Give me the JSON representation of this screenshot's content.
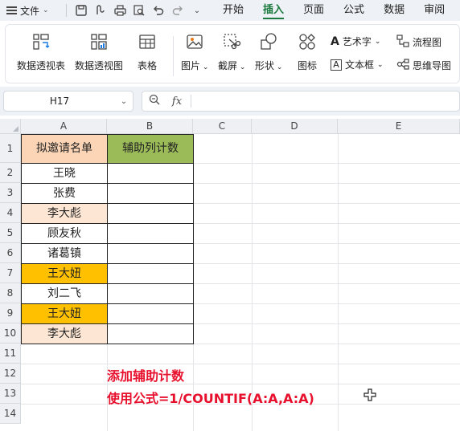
{
  "menu": {
    "file_label": "文件",
    "tabs": [
      "开始",
      "插入",
      "页面",
      "公式",
      "数据",
      "审阅"
    ],
    "active_tab": "插入"
  },
  "ribbon": {
    "pivot_table": "数据透视表",
    "pivot_chart": "数据透视图",
    "table": "表格",
    "picture": "图片",
    "screenshot": "截屏",
    "shapes": "形状",
    "icons": "图标",
    "wordart": "艺术字",
    "textbox": "文本框",
    "flowchart": "流程图",
    "mindmap": "思维导图"
  },
  "formula_bar": {
    "name_box": "H17",
    "fx_label": "fx",
    "formula": ""
  },
  "sheet": {
    "columns": [
      "A",
      "B",
      "C",
      "D",
      "E"
    ],
    "rows": [
      "1",
      "2",
      "3",
      "4",
      "5",
      "6",
      "7",
      "8",
      "9",
      "10",
      "11",
      "12",
      "13",
      "14"
    ],
    "header": {
      "a1": "拟邀请名单",
      "b1": "辅助列计数"
    },
    "names": [
      "王晓",
      "张费",
      "李大彪",
      "顾友秋",
      "诸葛镇",
      "王大妞",
      "刘二飞",
      "王大妞",
      "李大彪"
    ],
    "name_fills": [
      "#ffffff",
      "#ffffff",
      "#fde6d3",
      "#ffffff",
      "#ffffff",
      "#ffc000",
      "#ffffff",
      "#ffc000",
      "#fde6d3"
    ],
    "header_fills": {
      "a1": "#fbd5b5",
      "b1": "#9bbb59"
    }
  },
  "annotation": {
    "line1": "添加辅助计数",
    "line2": "使用公式=1/COUNTIF(A:A,A:A)",
    "color": "#e8112d"
  },
  "colors": {
    "accent": "#1a7a3e"
  }
}
